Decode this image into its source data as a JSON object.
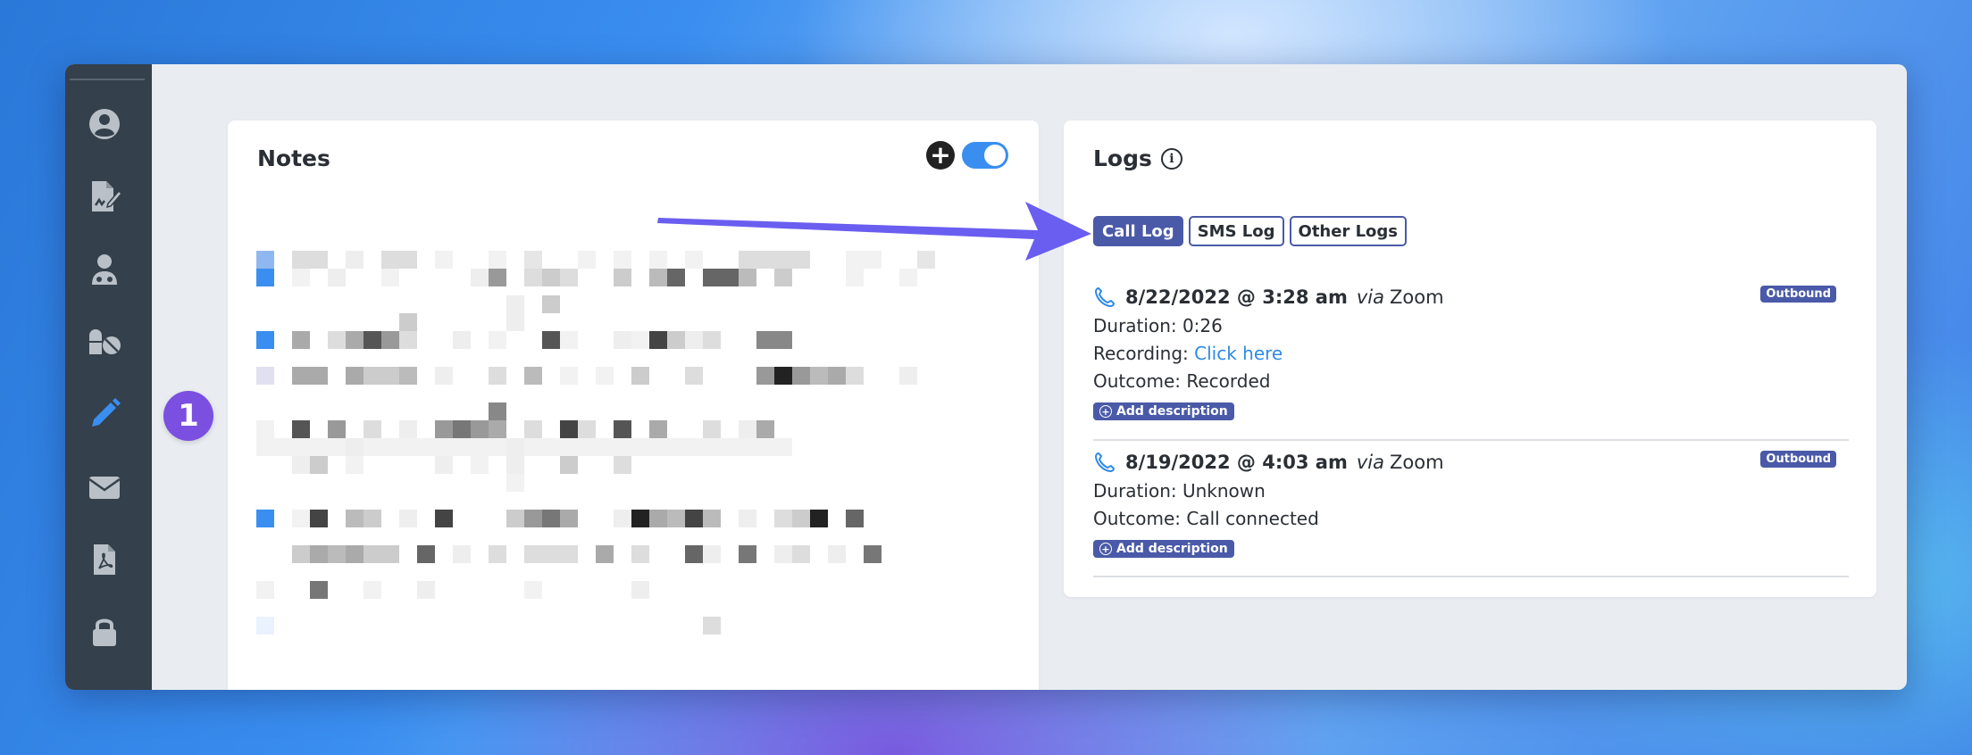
{
  "step_badge": "1",
  "sidebar": {
    "items": [
      {
        "icon": "user-circle-icon"
      },
      {
        "icon": "file-signature-icon"
      },
      {
        "icon": "user-doctor-icon"
      },
      {
        "icon": "pills-icon"
      },
      {
        "icon": "pencil-icon",
        "active": true
      },
      {
        "icon": "envelope-icon"
      },
      {
        "icon": "file-pdf-icon"
      },
      {
        "icon": "lock-icon"
      }
    ]
  },
  "notes": {
    "title": "Notes"
  },
  "logs": {
    "title": "Logs",
    "tabs": [
      {
        "label": "Call Log",
        "active": true
      },
      {
        "label": "SMS Log",
        "active": false
      },
      {
        "label": "Other Logs",
        "active": false
      }
    ],
    "entries": [
      {
        "date": "8/22/2022 @ 3:28 am",
        "via_word": "via",
        "via": "Zoom",
        "badge": "Outbound",
        "duration": "Duration: 0:26",
        "recording_label": "Recording:",
        "recording_link": "Click here",
        "outcome": "Outcome: Recorded",
        "add_description": "Add description"
      },
      {
        "date": "8/19/2022 @ 4:03 am",
        "via_word": "via",
        "via": "Zoom",
        "badge": "Outbound",
        "duration": "Duration: Unknown",
        "outcome": "Outcome: Call connected",
        "add_description": "Add description"
      }
    ]
  },
  "colors": {
    "accent": "#3a8ef0",
    "tab_primary": "#4a5aa8",
    "sidebar_bg": "#34404b",
    "arrow": "#6a5ef0"
  }
}
